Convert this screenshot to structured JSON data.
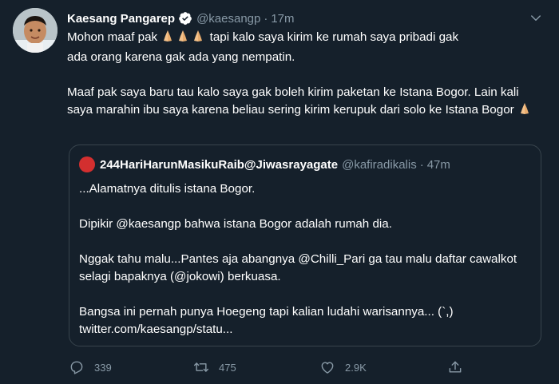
{
  "author": {
    "name": "Kaesang Pangarep",
    "handle": "@kaesangp",
    "time": "17m",
    "separator": "·"
  },
  "tweet": {
    "line1_prefix": "Mohon maaf pak",
    "line1_suffix": " tapi kalo saya kirim ke rumah saya pribadi gak",
    "line1_cont": "ada orang karena gak ada yang nempatin.",
    "para2": "Maaf pak saya baru tau kalo saya gak boleh kirim paketan ke Istana Bogor. Lain kali saya marahin ibu saya karena beliau sering kirim kerupuk dari solo ke Istana Bogor"
  },
  "quoted": {
    "name": "244HariHarunMasikuRaib@Jiwasrayagate",
    "handle": "@kafiradikalis",
    "time": "47m",
    "separator": "·",
    "paragraphs": [
      "...Alamatnya ditulis istana Bogor.",
      "Dipikir @kaesangp bahwa istana Bogor adalah rumah dia.",
      "Nggak tahu malu...Pantes aja abangnya @Chilli_Pari ga tau malu daftar cawalkot selagi bapaknya (@jokowi) berkuasa.",
      "Bangsa ini pernah punya Hoegeng tapi kalian ludahi warisannya... (`,)"
    ],
    "link": "twitter.com/kaesangp/statu..."
  },
  "actions": {
    "reply_count": "339",
    "retweet_count": "475",
    "like_count": "2.9K"
  },
  "colors": {
    "background": "#15202b",
    "muted": "#8899a6",
    "border": "#38444d",
    "verified": "#1da1f2"
  },
  "icons": [
    "avatar-kaesang",
    "verified-badge-icon",
    "chevron-down-icon",
    "folded-hands-emoji",
    "reply-icon",
    "retweet-icon",
    "like-icon",
    "share-icon"
  ]
}
